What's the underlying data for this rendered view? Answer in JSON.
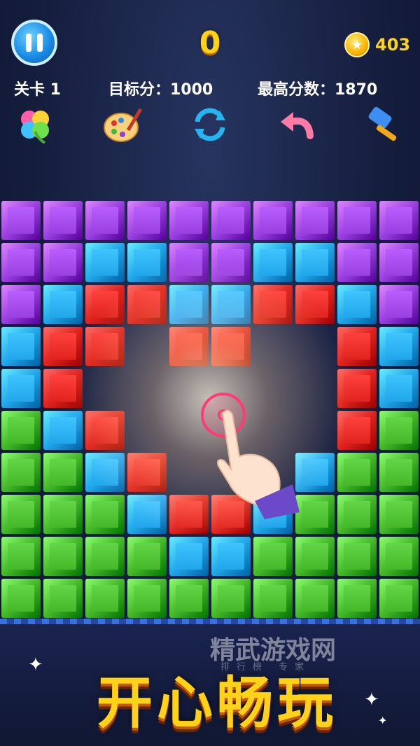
{
  "hud": {
    "score": "0",
    "coins": "403",
    "level_label": "关卡 1",
    "target_label": "目标分：1000",
    "best_label": "最高分数：1870"
  },
  "tools": [
    {
      "name": "clover-icon"
    },
    {
      "name": "palette-icon"
    },
    {
      "name": "refresh-icon"
    },
    {
      "name": "undo-icon"
    },
    {
      "name": "hammer-icon"
    }
  ],
  "colors": {
    "P": "#9a3fe0",
    "B": "#21a6ea",
    "R": "#e0231f",
    "G": "#45b82a"
  },
  "board": [
    "PPPPPPPPPP",
    "PPBBPPBBPP",
    "PBRRBBRRBP",
    "BRR.RR..RB",
    "BR......RB",
    "GBR.....RG",
    "GGBR...BGG",
    "GGGBRRBGGG",
    "GGGGBBGGGG",
    "GGGGGGGGGG"
  ],
  "slogan": "开心畅玩",
  "watermark": {
    "title": "精武游戏网",
    "subtitle": "排行榜  专家"
  }
}
